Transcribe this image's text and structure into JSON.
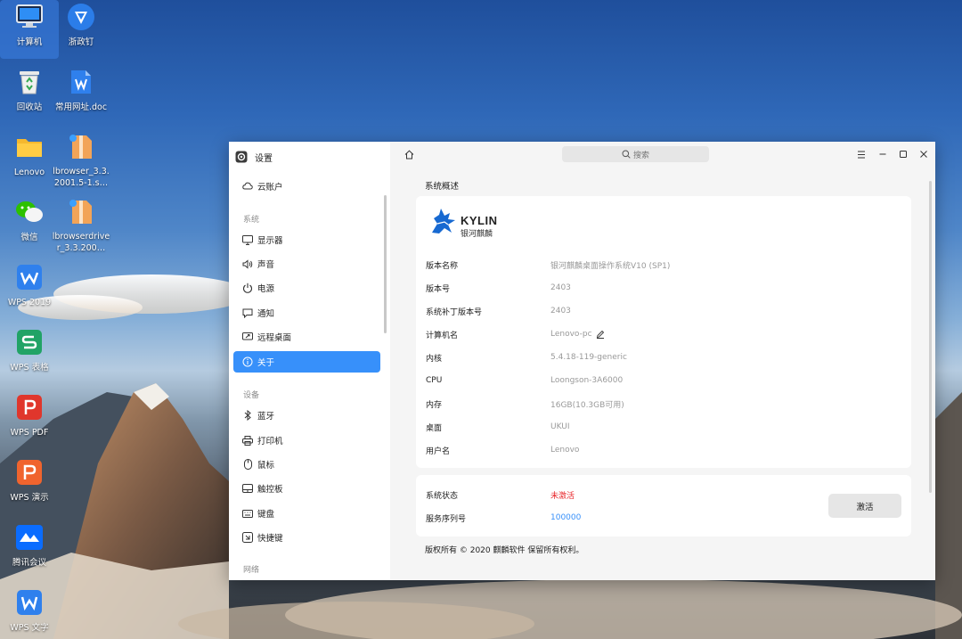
{
  "desktop": {
    "icons": [
      {
        "label": "计算机",
        "icon": "computer-icon"
      },
      {
        "label": "浙政钉",
        "icon": "zhezhengding-icon"
      },
      {
        "label": "回收站",
        "icon": "recycle-bin-icon"
      },
      {
        "label": "常用网址.doc",
        "icon": "wps-doc-icon"
      },
      {
        "label": "Lenovo",
        "icon": "folder-icon"
      },
      {
        "label": "lbrowser_3.3.2001.5-1.s…",
        "icon": "package-icon"
      },
      {
        "label": "微信",
        "icon": "wechat-icon"
      },
      {
        "label": "lbrowserdriver_3.3.200…",
        "icon": "package-icon"
      },
      {
        "label": "WPS 2019",
        "icon": "wps-icon"
      },
      {
        "label": "WPS 表格",
        "icon": "wps-sheet-icon"
      },
      {
        "label": "WPS PDF",
        "icon": "wps-pdf-icon"
      },
      {
        "label": "WPS 演示",
        "icon": "wps-presentation-icon"
      },
      {
        "label": "腾讯会议",
        "icon": "tencent-meeting-icon"
      },
      {
        "label": "WPS 文字",
        "icon": "wps-writer-icon"
      }
    ]
  },
  "window": {
    "app_title": "设置",
    "search_placeholder": "搜索",
    "sidebar": {
      "account": "云账户",
      "groups": [
        {
          "label": "系统",
          "items": [
            "显示器",
            "声音",
            "电源",
            "通知",
            "远程桌面",
            "关于"
          ]
        },
        {
          "label": "设备",
          "items": [
            "蓝牙",
            "打印机",
            "鼠标",
            "触控板",
            "键盘",
            "快捷键"
          ]
        },
        {
          "label": "网络"
        }
      ]
    },
    "about": {
      "section_title": "系统概述",
      "logo_text": "KYLIN",
      "logo_subtext": "银河麒麟",
      "rows": [
        {
          "key": "版本名称",
          "value": "银河麒麟桌面操作系统V10 (SP1)"
        },
        {
          "key": "版本号",
          "value": "2403"
        },
        {
          "key": "系统补丁版本号",
          "value": "2403"
        },
        {
          "key": "计算机名",
          "value": "Lenovo-pc"
        },
        {
          "key": "内核",
          "value": "5.4.18-119-generic"
        },
        {
          "key": "CPU",
          "value": "Loongson-3A6000"
        },
        {
          "key": "内存",
          "value": "16GB(10.3GB可用)"
        },
        {
          "key": "桌面",
          "value": "UKUI"
        },
        {
          "key": "用户名",
          "value": "Lenovo"
        }
      ],
      "status": {
        "key": "系统状态",
        "value": "未激活",
        "color": "#e8262a"
      },
      "serial": {
        "key": "服务序列号",
        "value": "100000",
        "color": "#3790fa"
      },
      "activate_label": "激活",
      "copyright": "版权所有 © 2020 麒麟软件 保留所有权利。"
    }
  },
  "colors": {
    "accent": "#3790fa",
    "status_red": "#e8262a"
  }
}
